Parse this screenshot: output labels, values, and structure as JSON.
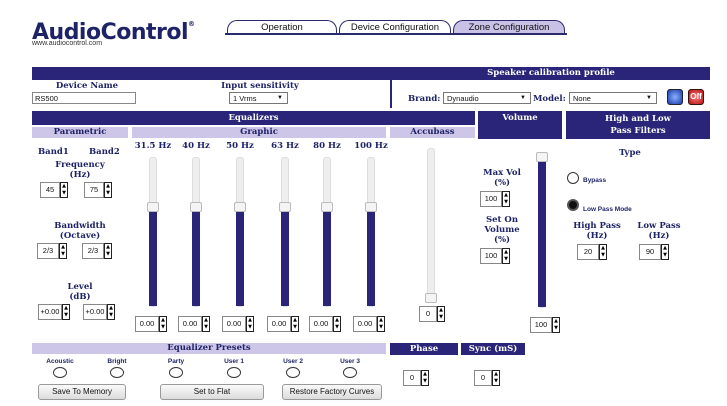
{
  "brand": {
    "logo": "AudioControl",
    "website": "www.audiocontrol.com"
  },
  "tabs": [
    {
      "label": "Operation"
    },
    {
      "label": "Device Configuration"
    },
    {
      "label": "Zone Configuration"
    }
  ],
  "speaker_calibration": {
    "header": "Speaker calibration profile",
    "brand_label": "Brand:",
    "brand_value": "Dynaudio",
    "model_label": "Model:",
    "model_value": "None"
  },
  "device": {
    "name_label": "Device Name",
    "name_value": "RS500",
    "sensitivity_label": "Input sensitivity",
    "sensitivity_value": "1 Vrms"
  },
  "equalizers": {
    "header": "Equalizers",
    "parametric": {
      "header": "Parametric",
      "band1_label": "Band1",
      "band2_label": "Band2",
      "frequency_label": "Frequency",
      "frequency_unit": "(Hz)",
      "freq_band1": "45",
      "freq_band2": "75",
      "bandwidth_label": "Bandwidth",
      "bandwidth_unit": "(Octave)",
      "bw_band1": "2/3",
      "bw_band2": "2/3",
      "level_label": "Level",
      "level_unit": "(dB)",
      "level_band1": "+0.00",
      "level_band2": "+0.00"
    },
    "graphic": {
      "header": "Graphic",
      "bands": [
        {
          "label": "31.5 Hz",
          "value": "0.00",
          "level": 0.5
        },
        {
          "label": "40 Hz",
          "value": "0.00",
          "level": 0.5
        },
        {
          "label": "50 Hz",
          "value": "0.00",
          "level": 0.5
        },
        {
          "label": "63 Hz",
          "value": "0.00",
          "level": 0.5
        },
        {
          "label": "80 Hz",
          "value": "0.00",
          "level": 0.5
        },
        {
          "label": "100 Hz",
          "value": "0.00",
          "level": 0.5
        }
      ]
    },
    "accubass": {
      "header": "Accubass",
      "value": "0",
      "level": 0
    }
  },
  "volume": {
    "header": "Volume",
    "max_vol_label": "Max Vol",
    "max_vol_unit": "(%)",
    "max_vol_value": "100",
    "set_on_label_1": "Set On",
    "set_on_label_2": "Volume",
    "set_on_unit": "(%)",
    "set_on_value": "100",
    "slider_value": "100",
    "level": 1.0
  },
  "filters": {
    "header_line1": "High and Low",
    "header_line2": "Pass Filters",
    "type_label": "Type",
    "bypass_label": "Bypass",
    "lowpass_mode_label": "Low Pass Mode",
    "high_pass_label": "High Pass",
    "high_pass_unit": "(Hz)",
    "high_pass_value": "20",
    "low_pass_label": "Low Pass",
    "low_pass_unit": "(Hz)",
    "low_pass_value": "90"
  },
  "presets": {
    "header": "Equalizer Presets",
    "items": [
      {
        "label": "Acoustic"
      },
      {
        "label": "Bright"
      },
      {
        "label": "Party"
      },
      {
        "label": "User 1"
      },
      {
        "label": "User 2"
      },
      {
        "label": "User 3"
      }
    ],
    "save_label": "Save To Memory",
    "flat_label": "Set to Flat",
    "restore_label": "Restore Factory Curves"
  },
  "phase": {
    "header": "Phase",
    "value": "0"
  },
  "sync": {
    "header": "Sync (mS)",
    "value": "0"
  },
  "colors": {
    "primary": "#2a2578",
    "sub_header": "#cec6e8",
    "tab_active": "#c9c1e6"
  }
}
